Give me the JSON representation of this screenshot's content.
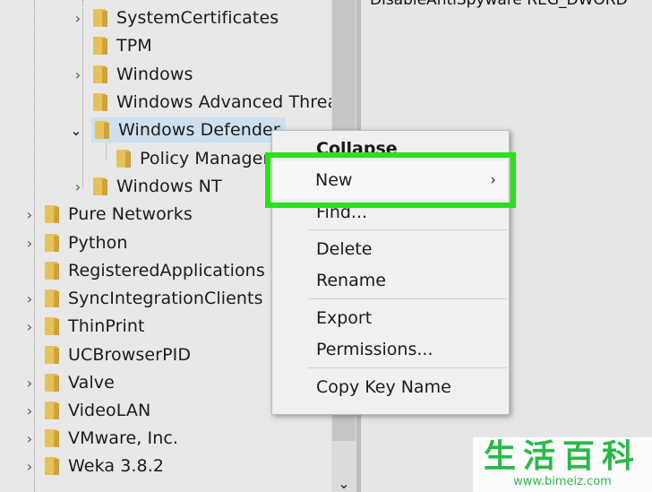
{
  "tree": {
    "items": [
      {
        "label": "SystemCertificates",
        "expander": "closed"
      },
      {
        "label": "TPM",
        "expander": "none"
      },
      {
        "label": "Windows",
        "expander": "closed"
      },
      {
        "label": "Windows Advanced Threat",
        "expander": "none"
      },
      {
        "label": "Windows Defender",
        "expander": "open",
        "selected": true
      },
      {
        "label": "Policy Manager",
        "expander": "none"
      },
      {
        "label": "Windows NT",
        "expander": "closed"
      },
      {
        "label": "Pure Networks",
        "expander": "closed"
      },
      {
        "label": "Python",
        "expander": "closed"
      },
      {
        "label": "RegisteredApplications",
        "expander": "none"
      },
      {
        "label": "SyncIntegrationClients",
        "expander": "closed"
      },
      {
        "label": "ThinPrint",
        "expander": "closed"
      },
      {
        "label": "UCBrowserPID",
        "expander": "none"
      },
      {
        "label": "Valve",
        "expander": "closed"
      },
      {
        "label": "VideoLAN",
        "expander": "closed"
      },
      {
        "label": "VMware, Inc.",
        "expander": "closed"
      },
      {
        "label": "Weka 3.8.2",
        "expander": "closed"
      }
    ]
  },
  "right_pane": {
    "partial_value_text": "DisableAntiSpyware  REG_DWORD"
  },
  "context_menu": {
    "collapse": "Collapse",
    "new": "New",
    "new_arrow": "›",
    "find": "Find...",
    "delete": "Delete",
    "rename": "Rename",
    "export": "Export",
    "permissions": "Permissions...",
    "copy_key_name": "Copy Key Name"
  },
  "watermark": {
    "chinese": "生活百科",
    "url": "www.bimeiz.com"
  },
  "colors": {
    "highlight_border": "#29e01c",
    "selection": "#cde0ef",
    "folder": "#e6c25a"
  }
}
